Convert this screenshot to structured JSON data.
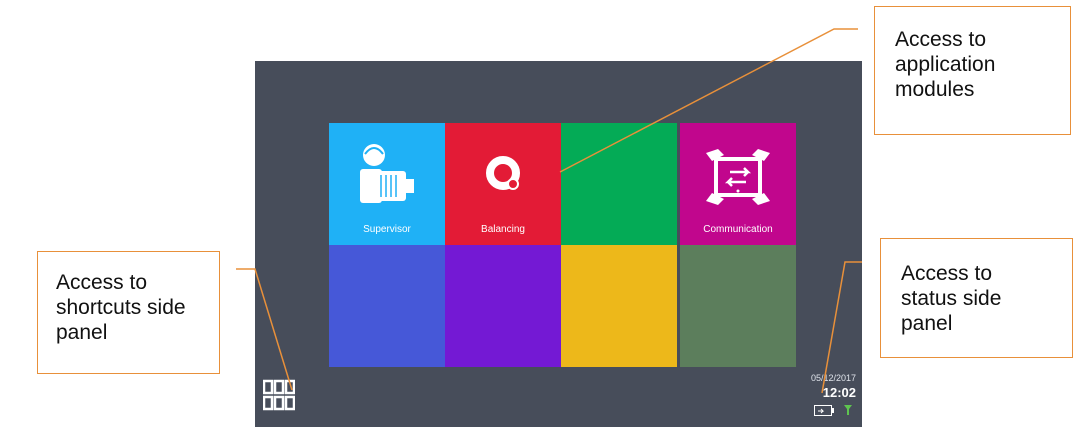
{
  "tiles": {
    "supervisor": {
      "label": "Supervisor",
      "color": "#1fb1f6"
    },
    "balancing": {
      "label": "Balancing",
      "color": "#e31b36"
    },
    "module3": {
      "label": "",
      "color": "#04ab56"
    },
    "communication": {
      "label": "Communication",
      "color": "#c1068d"
    },
    "module5": {
      "label": "",
      "color": "#4658d8"
    },
    "module6": {
      "label": "",
      "color": "#7419d4"
    },
    "module7": {
      "label": "",
      "color": "#edb81a"
    },
    "module8": {
      "label": "",
      "color": "#5c7e5c"
    }
  },
  "status": {
    "date": "05/12/2017",
    "time": "12:02",
    "battery_icon": "battery-icon",
    "connection_icon": "connection-icon"
  },
  "shortcuts_icon": "grid-icon",
  "callouts": {
    "modules": "Access to\napplication\nmodules",
    "shortcuts": "Access to\nshortcuts side\npanel",
    "status": "Access to\nstatus side\npanel"
  },
  "colors": {
    "screen_bg": "#474d5a",
    "callout_border": "#e8903a"
  }
}
